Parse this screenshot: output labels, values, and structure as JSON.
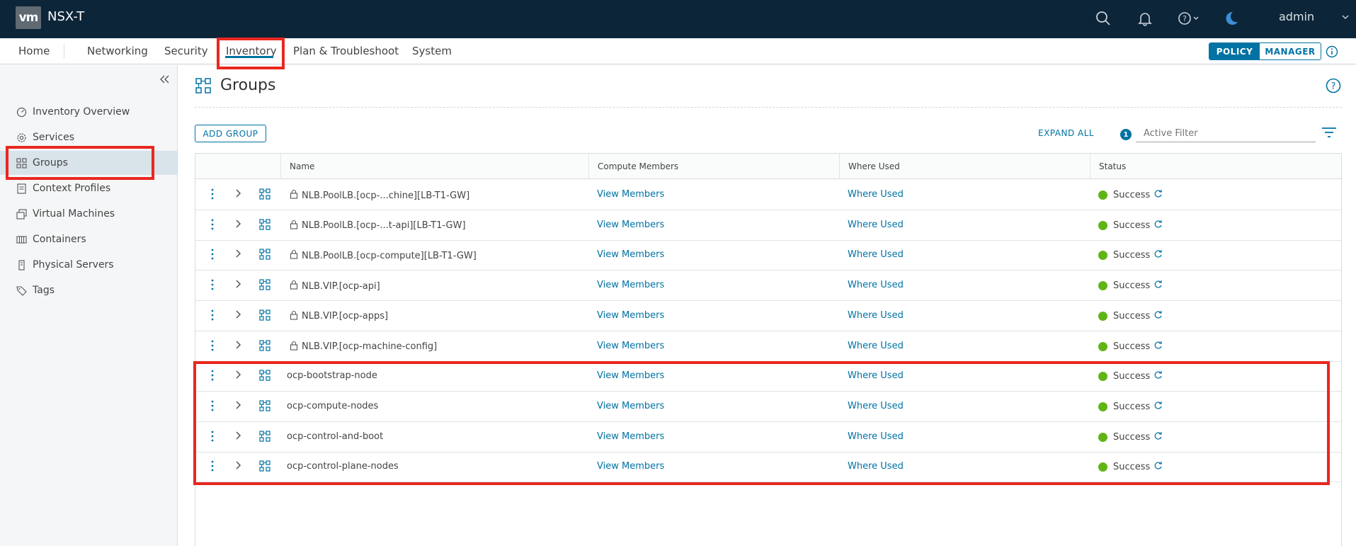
{
  "header": {
    "logo_text": "vm",
    "app_title": "NSX-T",
    "user": "admin",
    "icons": [
      "search-icon",
      "bell-icon",
      "help-icon",
      "moon-icon"
    ]
  },
  "nav": {
    "tabs": [
      "Home",
      "Networking",
      "Security",
      "Inventory",
      "Plan & Troubleshoot",
      "System"
    ],
    "active_tab": "Inventory",
    "mode_toggle": {
      "policy": "POLICY",
      "manager": "MANAGER",
      "selected": "POLICY"
    }
  },
  "sidebar": {
    "items": [
      {
        "label": "Inventory Overview",
        "icon": "gauge-icon"
      },
      {
        "label": "Services",
        "icon": "gear-icon"
      },
      {
        "label": "Groups",
        "icon": "groups-icon"
      },
      {
        "label": "Context Profiles",
        "icon": "profile-icon"
      },
      {
        "label": "Virtual Machines",
        "icon": "vm-icon"
      },
      {
        "label": "Containers",
        "icon": "container-icon"
      },
      {
        "label": "Physical Servers",
        "icon": "server-icon"
      },
      {
        "label": "Tags",
        "icon": "tag-icon"
      }
    ],
    "active": "Groups"
  },
  "page": {
    "title": "Groups",
    "add_button": "ADD GROUP",
    "expand_all": "EXPAND ALL",
    "filter_count": "1",
    "filter_placeholder": "Active Filter"
  },
  "table": {
    "columns": [
      "Name",
      "Compute Members",
      "Where Used",
      "Status"
    ],
    "rows": [
      {
        "name": "NLB.PoolLB.[ocp-...chine][LB-T1-GW]",
        "locked": true,
        "members": "View Members",
        "where_used": "Where Used",
        "status": "Success"
      },
      {
        "name": "NLB.PoolLB.[ocp-...t-api][LB-T1-GW]",
        "locked": true,
        "members": "View Members",
        "where_used": "Where Used",
        "status": "Success"
      },
      {
        "name": "NLB.PoolLB.[ocp-compute][LB-T1-GW]",
        "locked": true,
        "members": "View Members",
        "where_used": "Where Used",
        "status": "Success"
      },
      {
        "name": "NLB.VIP.[ocp-api]",
        "locked": true,
        "members": "View Members",
        "where_used": "Where Used",
        "status": "Success"
      },
      {
        "name": "NLB.VIP.[ocp-apps]",
        "locked": true,
        "members": "View Members",
        "where_used": "Where Used",
        "status": "Success"
      },
      {
        "name": "NLB.VIP.[ocp-machine-config]",
        "locked": true,
        "members": "View Members",
        "where_used": "Where Used",
        "status": "Success"
      },
      {
        "name": "ocp-bootstrap-node",
        "locked": false,
        "members": "View Members",
        "where_used": "Where Used",
        "status": "Success"
      },
      {
        "name": "ocp-compute-nodes",
        "locked": false,
        "members": "View Members",
        "where_used": "Where Used",
        "status": "Success"
      },
      {
        "name": "ocp-control-and-boot",
        "locked": false,
        "members": "View Members",
        "where_used": "Where Used",
        "status": "Success"
      },
      {
        "name": "ocp-control-plane-nodes",
        "locked": false,
        "members": "View Members",
        "where_used": "Where Used",
        "status": "Success"
      }
    ]
  },
  "colors": {
    "header_bg": "#0d2538",
    "accent": "#0072a3",
    "success": "#60b515",
    "annotation": "#e8281f"
  }
}
